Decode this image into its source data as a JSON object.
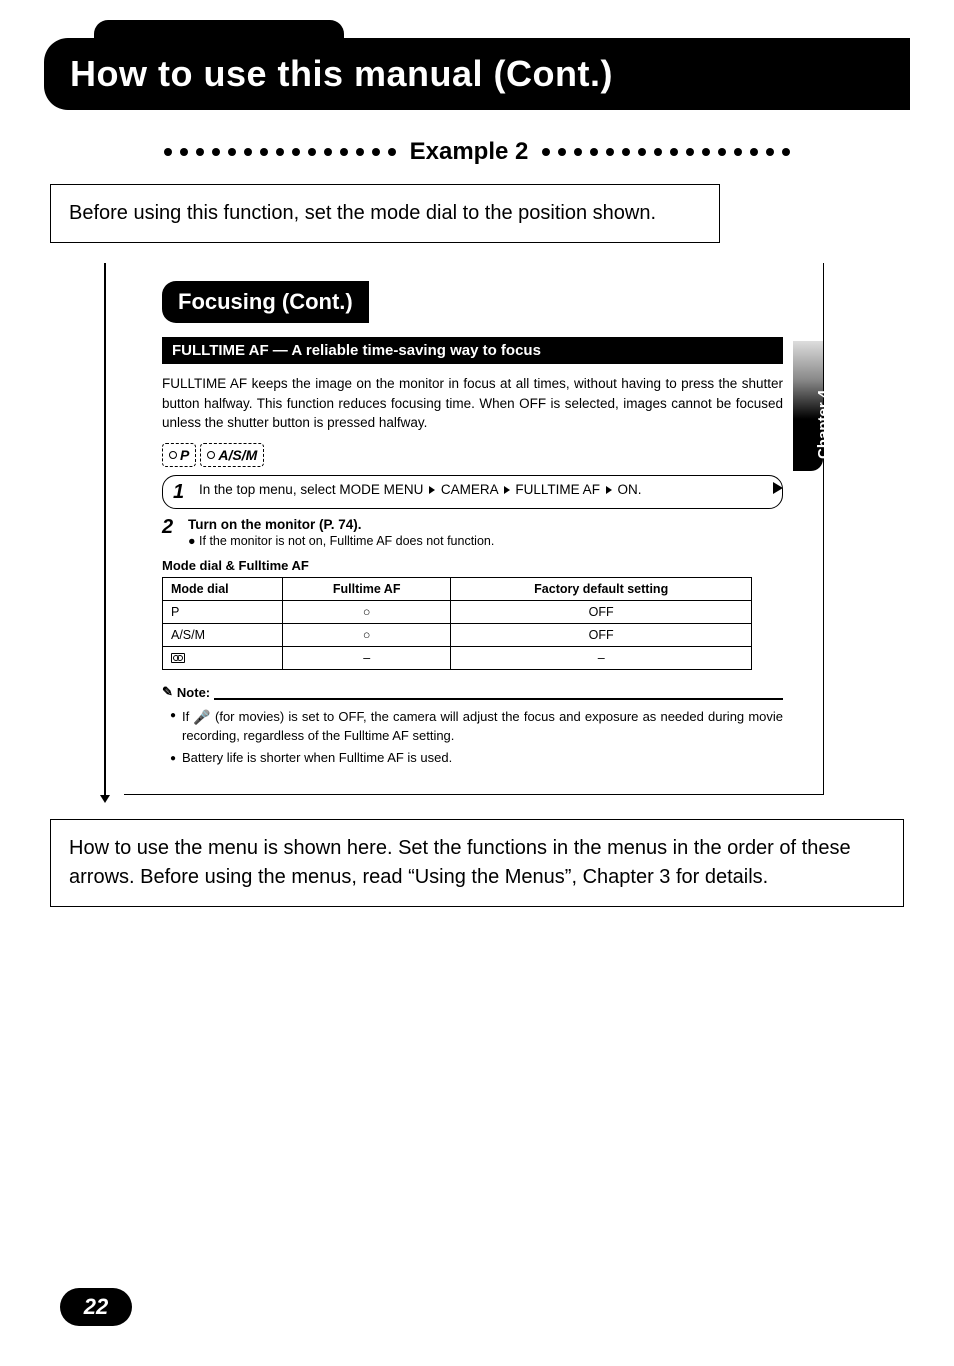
{
  "page_number": "22",
  "header_title": "How to use this manual (Cont.)",
  "example_label": "Example 2",
  "callout_top": "Before using this function, set the mode dial to the position shown.",
  "callout_bottom": "How to use the menu is shown here. Set the functions in the menus in the order of these arrows. Before using the menus, read “Using the Menus”, Chapter 3 for details.",
  "manual": {
    "section_title": "Focusing (Cont.)",
    "chapter_tab": "Chapter 4",
    "fulltime_title": "FULLTIME AF — A reliable time-saving way to focus",
    "fulltime_desc": "FULLTIME AF keeps the image on the monitor in focus at all times, without having to press the shutter button halfway. This function reduces focusing time. When OFF is selected, images cannot be focused unless the shutter button is pressed halfway.",
    "mode_icons": [
      "P",
      "A/S/M"
    ],
    "step1_pre": "In the top menu, select MODE MENU",
    "step1_m1": "CAMERA",
    "step1_m2": "FULLTIME AF",
    "step1_m3": "ON.",
    "step2_title": "Turn on the monitor (P. 74).",
    "step2_sub": "If the monitor is not on, Fulltime AF does not function.",
    "table_caption": "Mode dial & Fulltime AF",
    "table": {
      "headers": [
        "Mode dial",
        "Fulltime AF",
        "Factory default setting"
      ],
      "rows": [
        [
          "P",
          "○",
          "OFF"
        ],
        [
          "A/S/M",
          "○",
          "OFF"
        ],
        [
          "__MOVIE__",
          "–",
          "–"
        ]
      ]
    },
    "note_label": "Note:",
    "notes": [
      "If    (for movies) is set to OFF, the camera will adjust the focus and exposure as needed during movie recording, regardless of the Fulltime AF setting.",
      "Battery life is shorter when Fulltime AF is used."
    ],
    "note1_prefix": "If ",
    "note1_suffix": " (for movies) is set to OFF, the camera will adjust the focus and exposure as needed during movie recording, regardless of the Fulltime AF setting."
  },
  "chart_data": {
    "type": "table",
    "title": "Mode dial & Fulltime AF",
    "columns": [
      "Mode dial",
      "Fulltime AF",
      "Factory default setting"
    ],
    "rows": [
      {
        "mode_dial": "P",
        "fulltime_af": "available",
        "factory_default": "OFF"
      },
      {
        "mode_dial": "A/S/M",
        "fulltime_af": "available",
        "factory_default": "OFF"
      },
      {
        "mode_dial": "Movie",
        "fulltime_af": "–",
        "factory_default": "–"
      }
    ]
  }
}
